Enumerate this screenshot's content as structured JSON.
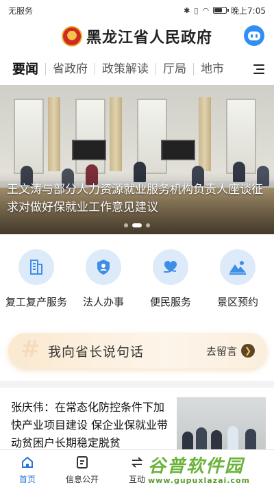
{
  "status_bar": {
    "carrier": "无服务",
    "time": "晚上7:05",
    "battery_level_percent": 70
  },
  "header": {
    "title": "黑龙江省人民政府",
    "emblem_icon": "national-emblem-icon",
    "assistant_icon": "robot-assistant-icon"
  },
  "nav": {
    "tabs": [
      {
        "label": "要闻",
        "active": true
      },
      {
        "label": "省政府",
        "active": false
      },
      {
        "label": "政策解读",
        "active": false
      },
      {
        "label": "厅局",
        "active": false
      },
      {
        "label": "地市",
        "active": false
      }
    ],
    "menu_icon": "hamburger-menu-icon"
  },
  "banner": {
    "caption": "王文涛与部分人力资源就业服务机构负责人座谈征求对做好保就业工作意见建议",
    "slide_count": 3,
    "active_slide": 2
  },
  "services": [
    {
      "label": "复工复产服务",
      "icon": "building-icon"
    },
    {
      "label": "法人办事",
      "icon": "shield-person-icon"
    },
    {
      "label": "便民服务",
      "icon": "heart-hand-icon"
    },
    {
      "label": "景区预约",
      "icon": "mountain-landscape-icon"
    }
  ],
  "governor_banner": {
    "title": "我向省长说句话",
    "action": "去留言"
  },
  "news": [
    {
      "title": "张庆伟：在常态化防控条件下加快产业项目建设 保企业保就业带动贫困户长期稳定脱贫"
    }
  ],
  "bottom_nav": [
    {
      "label": "首页",
      "icon": "home-icon",
      "active": true
    },
    {
      "label": "信息公开",
      "icon": "document-icon",
      "active": false
    },
    {
      "label": "互动",
      "icon": "exchange-icon",
      "active": false
    }
  ],
  "watermark": {
    "title": "谷普软件园",
    "url": "www.gupuxlazai.com"
  },
  "colors": {
    "accent": "#2a74d6",
    "service_icon_bg": "#dceaf9",
    "service_icon_fg": "#3f8de6",
    "governor_bg": "#fbe9d0"
  }
}
